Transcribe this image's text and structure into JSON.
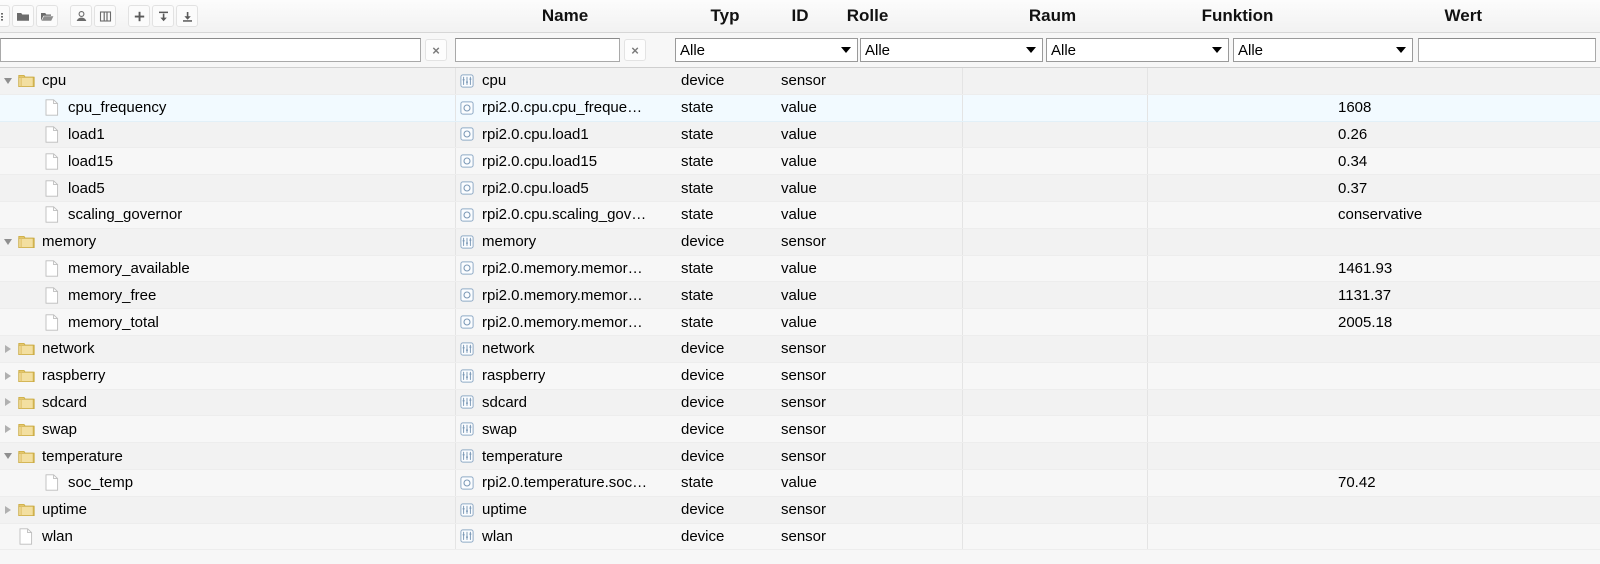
{
  "toolbar": {
    "buttons": [
      {
        "name": "list-icon",
        "label": "Liste"
      },
      {
        "name": "folder-closed-icon",
        "label": "Alle einklappen"
      },
      {
        "name": "folder-open-icon",
        "label": "Alle ausklappen"
      },
      {
        "name": "user-icon",
        "label": "Benutzer"
      },
      {
        "name": "columns-icon",
        "label": "Spalten"
      },
      {
        "name": "plus-icon",
        "label": "Neues Objekt"
      },
      {
        "name": "import-icon",
        "label": "Import"
      },
      {
        "name": "export-icon",
        "label": "Export"
      }
    ]
  },
  "columns": {
    "id": "ID",
    "name": "Name",
    "typ": "Typ",
    "rolle": "Rolle",
    "raum": "Raum",
    "funktion": "Funktion",
    "wert": "Wert"
  },
  "filters": {
    "id_value": "",
    "id_placeholder": "",
    "name_value": "",
    "name_placeholder": "",
    "clear_label": "×",
    "typ_selected": "Alle",
    "rolle_selected": "Alle",
    "raum_selected": "Alle",
    "funktion_selected": "Alle",
    "wert_value": "",
    "wert_placeholder": "",
    "options": [
      "Alle"
    ]
  },
  "rows": [
    {
      "tree": "cpu",
      "depth": 0,
      "node": "folder",
      "state": "expanded",
      "icon": "folder-icon",
      "name": "cpu",
      "name_icon": "device-icon",
      "typ": "device",
      "rolle": "sensor",
      "raum": "",
      "funktion": "",
      "wert": "",
      "selected": false
    },
    {
      "tree": "cpu_frequency",
      "depth": 1,
      "node": "leaf",
      "state": "none",
      "icon": "file-icon",
      "name": "rpi2.0.cpu.cpu_freque…",
      "name_icon": "state-icon",
      "typ": "state",
      "rolle": "value",
      "raum": "",
      "funktion": "",
      "wert": "1608",
      "selected": true
    },
    {
      "tree": "load1",
      "depth": 1,
      "node": "leaf",
      "state": "none",
      "icon": "file-icon",
      "name": "rpi2.0.cpu.load1",
      "name_icon": "state-icon",
      "typ": "state",
      "rolle": "value",
      "raum": "",
      "funktion": "",
      "wert": "0.26",
      "selected": false
    },
    {
      "tree": "load15",
      "depth": 1,
      "node": "leaf",
      "state": "none",
      "icon": "file-icon",
      "name": "rpi2.0.cpu.load15",
      "name_icon": "state-icon",
      "typ": "state",
      "rolle": "value",
      "raum": "",
      "funktion": "",
      "wert": "0.34",
      "selected": false
    },
    {
      "tree": "load5",
      "depth": 1,
      "node": "leaf",
      "state": "none",
      "icon": "file-icon",
      "name": "rpi2.0.cpu.load5",
      "name_icon": "state-icon",
      "typ": "state",
      "rolle": "value",
      "raum": "",
      "funktion": "",
      "wert": "0.37",
      "selected": false
    },
    {
      "tree": "scaling_governor",
      "depth": 1,
      "node": "leaf",
      "state": "none",
      "icon": "file-icon",
      "name": "rpi2.0.cpu.scaling_gov…",
      "name_icon": "state-icon",
      "typ": "state",
      "rolle": "value",
      "raum": "",
      "funktion": "",
      "wert": "conservative",
      "selected": false
    },
    {
      "tree": "memory",
      "depth": 0,
      "node": "folder",
      "state": "expanded",
      "icon": "folder-icon",
      "name": "memory",
      "name_icon": "device-icon",
      "typ": "device",
      "rolle": "sensor",
      "raum": "",
      "funktion": "",
      "wert": "",
      "selected": false
    },
    {
      "tree": "memory_available",
      "depth": 1,
      "node": "leaf",
      "state": "none",
      "icon": "file-icon",
      "name": "rpi2.0.memory.memor…",
      "name_icon": "state-icon",
      "typ": "state",
      "rolle": "value",
      "raum": "",
      "funktion": "",
      "wert": "1461.93",
      "selected": false
    },
    {
      "tree": "memory_free",
      "depth": 1,
      "node": "leaf",
      "state": "none",
      "icon": "file-icon",
      "name": "rpi2.0.memory.memor…",
      "name_icon": "state-icon",
      "typ": "state",
      "rolle": "value",
      "raum": "",
      "funktion": "",
      "wert": "1131.37",
      "selected": false
    },
    {
      "tree": "memory_total",
      "depth": 1,
      "node": "leaf",
      "state": "none",
      "icon": "file-icon",
      "name": "rpi2.0.memory.memor…",
      "name_icon": "state-icon",
      "typ": "state",
      "rolle": "value",
      "raum": "",
      "funktion": "",
      "wert": "2005.18",
      "selected": false
    },
    {
      "tree": "network",
      "depth": 0,
      "node": "folder",
      "state": "collapsed",
      "icon": "folder-icon",
      "name": "network",
      "name_icon": "device-icon",
      "typ": "device",
      "rolle": "sensor",
      "raum": "",
      "funktion": "",
      "wert": "",
      "selected": false
    },
    {
      "tree": "raspberry",
      "depth": 0,
      "node": "folder",
      "state": "collapsed",
      "icon": "folder-icon",
      "name": "raspberry",
      "name_icon": "device-icon",
      "typ": "device",
      "rolle": "sensor",
      "raum": "",
      "funktion": "",
      "wert": "",
      "selected": false
    },
    {
      "tree": "sdcard",
      "depth": 0,
      "node": "folder",
      "state": "collapsed",
      "icon": "folder-icon",
      "name": "sdcard",
      "name_icon": "device-icon",
      "typ": "device",
      "rolle": "sensor",
      "raum": "",
      "funktion": "",
      "wert": "",
      "selected": false
    },
    {
      "tree": "swap",
      "depth": 0,
      "node": "folder",
      "state": "collapsed",
      "icon": "folder-icon",
      "name": "swap",
      "name_icon": "device-icon",
      "typ": "device",
      "rolle": "sensor",
      "raum": "",
      "funktion": "",
      "wert": "",
      "selected": false
    },
    {
      "tree": "temperature",
      "depth": 0,
      "node": "folder",
      "state": "expanded",
      "icon": "folder-icon",
      "name": "temperature",
      "name_icon": "device-icon",
      "typ": "device",
      "rolle": "sensor",
      "raum": "",
      "funktion": "",
      "wert": "",
      "selected": false
    },
    {
      "tree": "soc_temp",
      "depth": 1,
      "node": "leaf",
      "state": "none",
      "icon": "file-icon",
      "name": "rpi2.0.temperature.soc…",
      "name_icon": "state-icon",
      "typ": "state",
      "rolle": "value",
      "raum": "",
      "funktion": "",
      "wert": "70.42",
      "selected": false
    },
    {
      "tree": "uptime",
      "depth": 0,
      "node": "folder",
      "state": "collapsed",
      "icon": "folder-icon",
      "name": "uptime",
      "name_icon": "device-icon",
      "typ": "device",
      "rolle": "sensor",
      "raum": "",
      "funktion": "",
      "wert": "",
      "selected": false
    },
    {
      "tree": "wlan",
      "depth": 0,
      "node": "leaf",
      "state": "none",
      "icon": "file-icon",
      "name": "wlan",
      "name_icon": "device-icon",
      "typ": "device",
      "rolle": "sensor",
      "raum": "",
      "funktion": "",
      "wert": "",
      "selected": false
    }
  ],
  "colors": {
    "selection": "#f2faff",
    "row_odd": "#f2f2f2",
    "row_even": "#f7f7f7",
    "folder": "#e8c96a",
    "icon_blue": "#8fa9c4"
  }
}
